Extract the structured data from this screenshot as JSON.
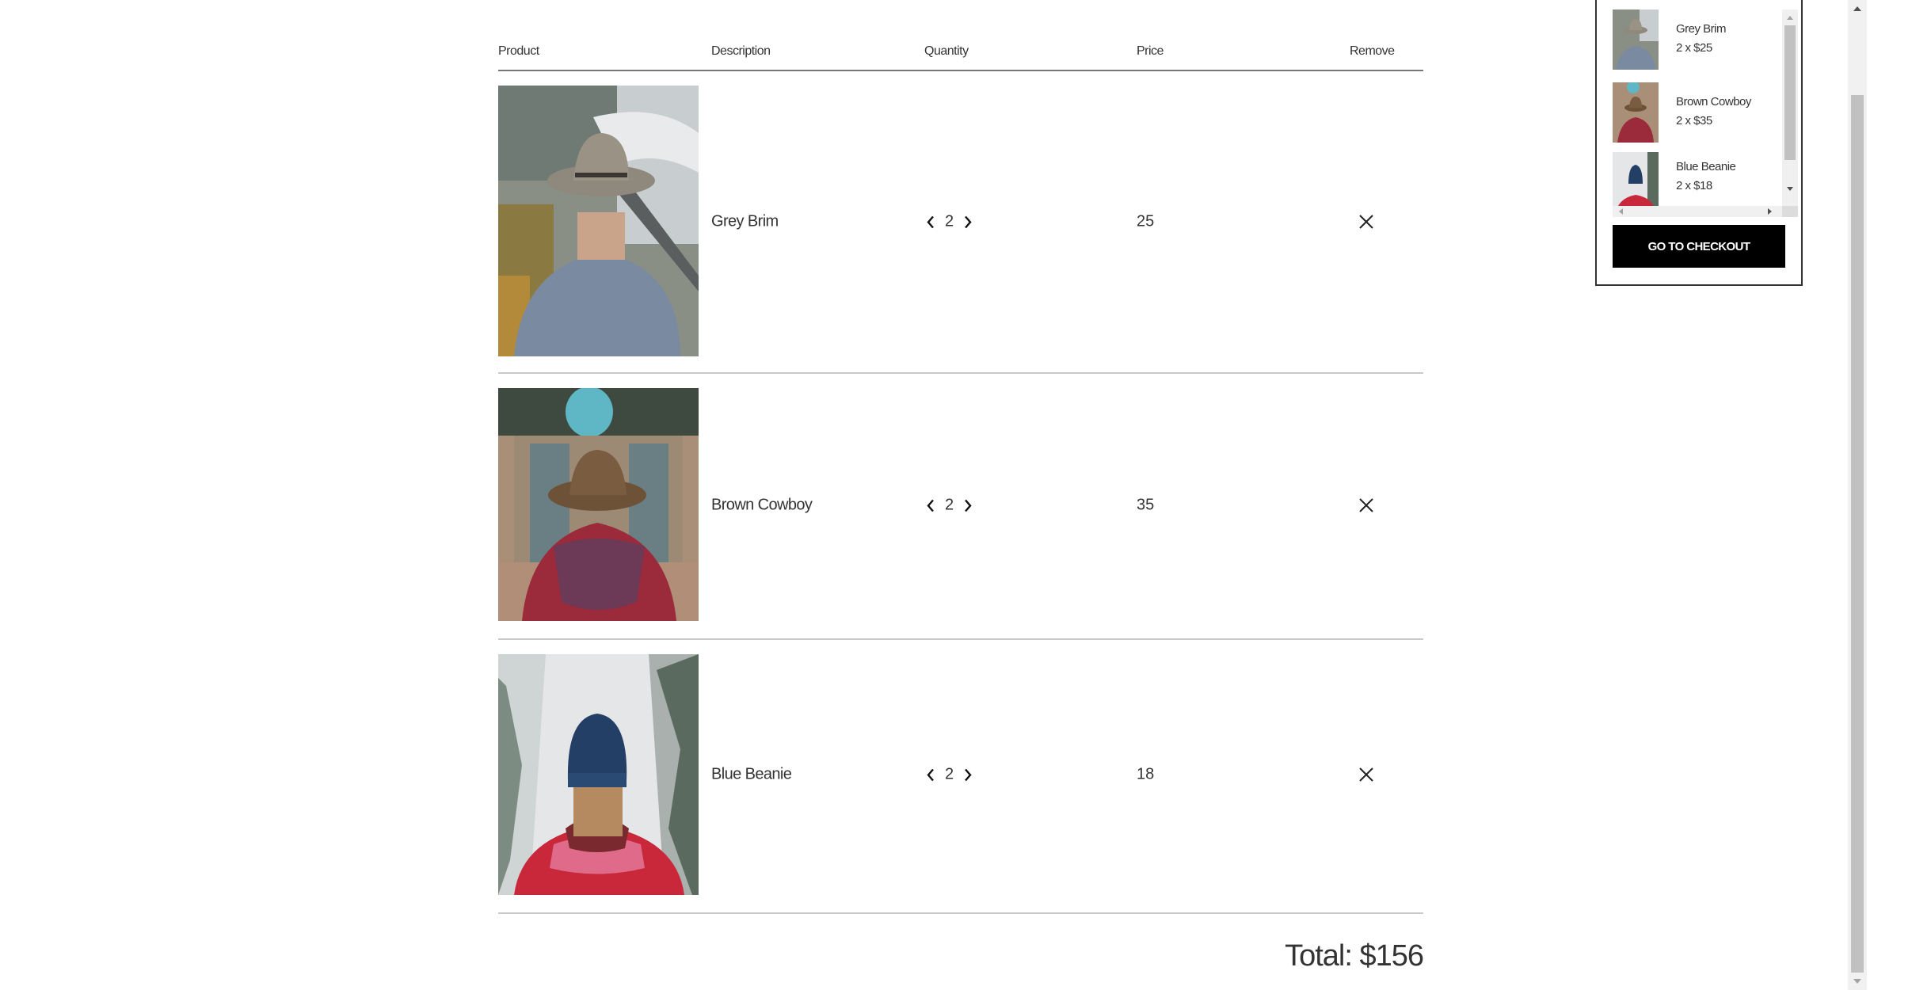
{
  "table": {
    "headers": {
      "product": "Product",
      "description": "Description",
      "quantity": "Quantity",
      "price": "Price",
      "remove": "Remove"
    },
    "rows": [
      {
        "description": "Grey Brim",
        "quantity": "2",
        "price": "25",
        "image": "photo of man in grey brim hat and blue sweater"
      },
      {
        "description": "Brown Cowboy",
        "quantity": "2",
        "price": "35",
        "image": "photo of person in brown cowboy hat and red scarf"
      },
      {
        "description": "Blue Beanie",
        "quantity": "2",
        "price": "18",
        "image": "photo of woman in blue beanie and red jacket in snow"
      }
    ],
    "total": "Total: $156"
  },
  "mini_cart": {
    "items": [
      {
        "name": "Grey Brim",
        "qty": "2 x $25"
      },
      {
        "name": "Brown Cowboy",
        "qty": "2 x $35"
      },
      {
        "name": "Blue Beanie",
        "qty": "2 x $18"
      }
    ],
    "checkout_label": "Go to checkout"
  },
  "icons": {
    "quantity_decrease": "chevron-left-icon",
    "quantity_increase": "chevron-right-icon",
    "remove": "close-icon"
  },
  "colors": {
    "text": "#333333",
    "header_rule": "#777777",
    "row_rule": "#c9c9c9",
    "checkout_bg": "#000000",
    "checkout_text": "#ffffff"
  }
}
